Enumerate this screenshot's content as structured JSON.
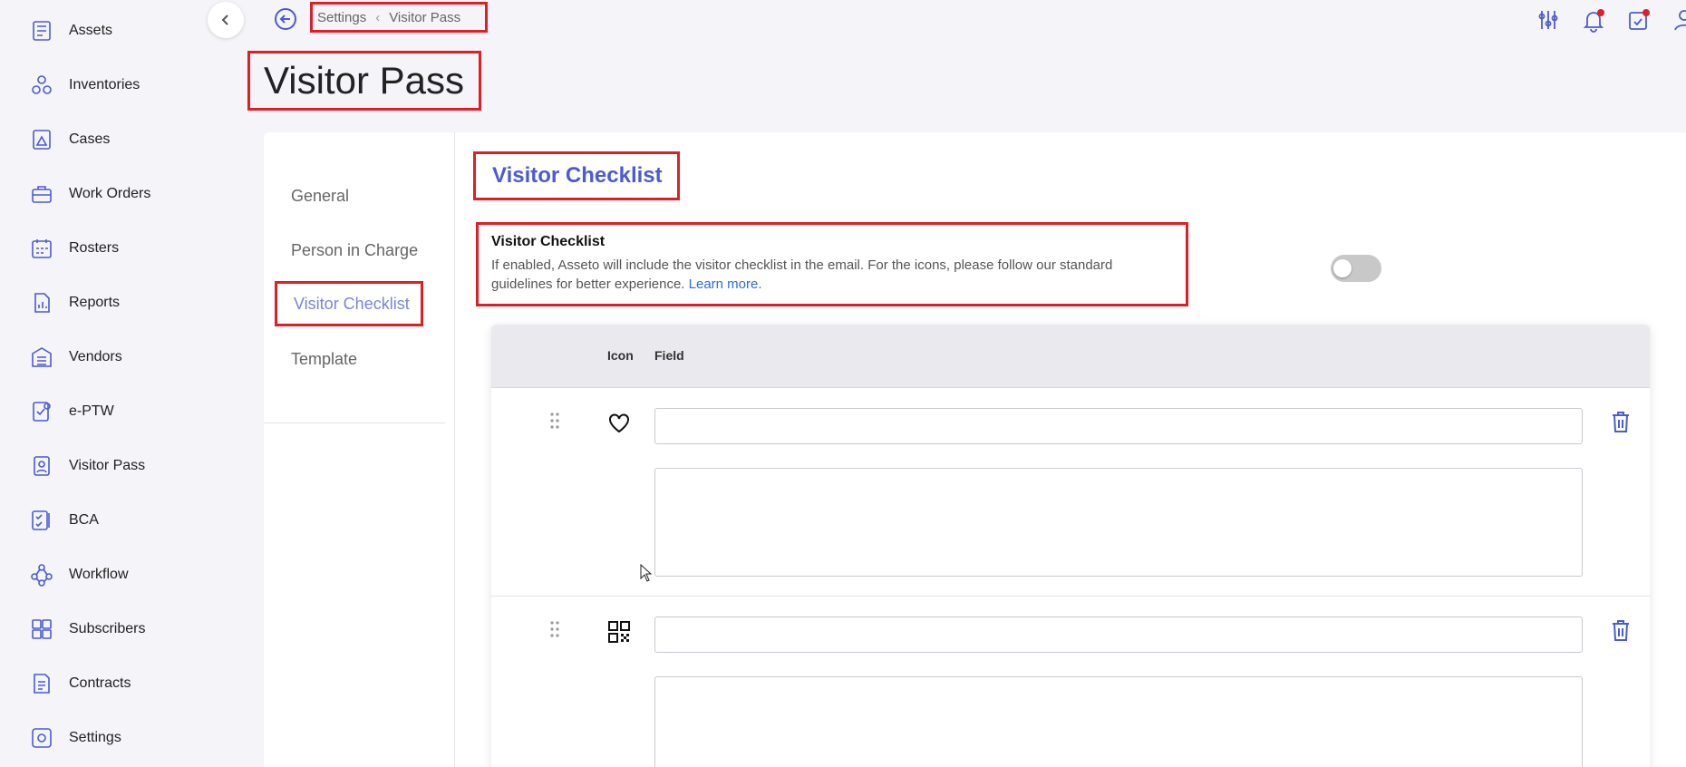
{
  "sidebar": {
    "items": [
      {
        "label": "Assets",
        "icon": "assets-icon"
      },
      {
        "label": "Inventories",
        "icon": "inventories-icon"
      },
      {
        "label": "Cases",
        "icon": "cases-icon"
      },
      {
        "label": "Work Orders",
        "icon": "work-orders-icon"
      },
      {
        "label": "Rosters",
        "icon": "rosters-icon"
      },
      {
        "label": "Reports",
        "icon": "reports-icon"
      },
      {
        "label": "Vendors",
        "icon": "vendors-icon"
      },
      {
        "label": "e-PTW",
        "icon": "eptw-icon"
      },
      {
        "label": "Visitor Pass",
        "icon": "visitor-pass-icon"
      },
      {
        "label": "BCA",
        "icon": "bca-icon"
      },
      {
        "label": "Workflow",
        "icon": "workflow-icon"
      },
      {
        "label": "Subscribers",
        "icon": "subscribers-icon"
      },
      {
        "label": "Contracts",
        "icon": "contracts-icon"
      },
      {
        "label": "Settings",
        "icon": "settings-icon"
      }
    ]
  },
  "breadcrumb": {
    "parent": "Settings",
    "current": "Visitor Pass"
  },
  "page_title": "Visitor Pass",
  "subnav": {
    "items": [
      "General",
      "Person in Charge",
      "Visitor Checklist",
      "Template"
    ],
    "active": "Visitor Checklist"
  },
  "section": {
    "title": "Visitor Checklist",
    "toggle_title": "Visitor Checklist",
    "toggle_desc": "If enabled, Asseto will include the visitor checklist in the email. For the icons, please follow our standard guidelines for better experience.",
    "toggle_link": "Learn more.",
    "toggle_enabled": false
  },
  "table": {
    "headers": {
      "icon": "Icon",
      "field": "Field"
    },
    "rows": [
      {
        "icon": "heart-icon",
        "field_value": "",
        "description_value": ""
      },
      {
        "icon": "qr-code-icon",
        "field_value": "",
        "description_value": ""
      }
    ]
  },
  "colors": {
    "accent": "#4b5bd1",
    "highlight": "#e01e26",
    "active_subnav": "#7a85de"
  }
}
